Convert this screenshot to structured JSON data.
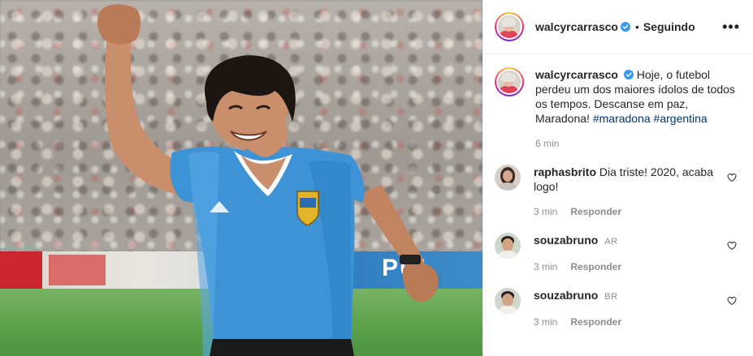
{
  "post": {
    "author": {
      "username": "walcyrcarrasco",
      "verified": true,
      "follow_status": "Seguindo",
      "separator": "•"
    },
    "more_options_label": "•••",
    "caption": {
      "username": "walcyrcarrasco",
      "text": "Hoje, o futebol perdeu um dos maiores ídolos de todos os tempos. Descanse em paz, Maradona!",
      "hashtag_1": "#maradona",
      "hashtag_2": "#argentina",
      "time": "6 min"
    },
    "photo": {
      "billboard_text": "PUI"
    },
    "comments": [
      {
        "username": "raphasbrito",
        "flag": "",
        "text": "Dia triste! 2020, acaba logo!",
        "time": "3 min",
        "reply_label": "Responder"
      },
      {
        "username": "souzabruno",
        "flag": "AR",
        "text": "",
        "time": "3 min",
        "reply_label": "Responder"
      },
      {
        "username": "souzabruno",
        "flag": "BR",
        "text": "",
        "time": "3 min",
        "reply_label": "Responder"
      }
    ]
  },
  "colors": {
    "text": "#262626",
    "secondary": "#8e8e8e",
    "hashtag": "#00376b",
    "verified": "#3897f0",
    "border": "#efefef"
  },
  "icons": {
    "verified": "verified-badge-icon",
    "like": "heart-outline-icon",
    "more": "ellipsis-icon"
  }
}
